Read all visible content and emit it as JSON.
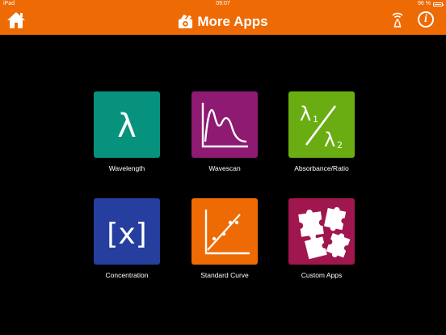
{
  "status_bar": {
    "carrier": "iPad",
    "time": "09:07",
    "battery": "96 %"
  },
  "nav": {
    "title": "More Apps",
    "home_icon": "home-icon",
    "wifi_icon": "wifi-icon",
    "info_icon": "info-icon",
    "info_glyph": "i"
  },
  "colors": {
    "bar": "#ee6a05",
    "wavelength": "#07927e",
    "wavescan": "#8e1a72",
    "absorbance": "#6aad13",
    "concentration": "#263e9d",
    "standard_curve": "#ee6a05",
    "custom_apps": "#a0164e"
  },
  "apps": {
    "wavelength": {
      "label": "Wavelength",
      "glyph": "λ"
    },
    "wavescan": {
      "label": "Wavescan"
    },
    "absorbance": {
      "label": "Absorbance/Ratio",
      "glyph1": "λ",
      "sub1": "1",
      "glyph2": "λ",
      "sub2": "2"
    },
    "concentration": {
      "label": "Concentration",
      "glyph": "[x]"
    },
    "standard_curve": {
      "label": "Standard Curve"
    },
    "custom_apps": {
      "label": "Custom Apps"
    }
  }
}
